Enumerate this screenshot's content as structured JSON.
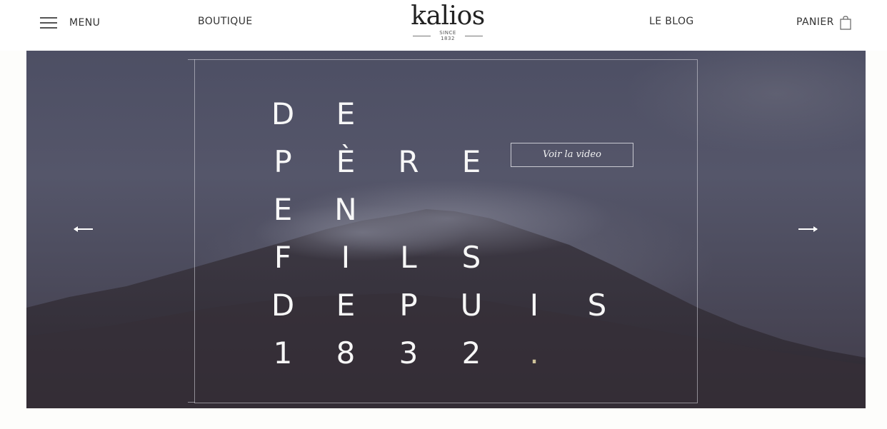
{
  "header": {
    "menu_label": "MENU",
    "boutique_label": "BOUTIQUE",
    "logo_text": "kalios",
    "logo_since": "SINCE 1832",
    "blog_label": "LE BLOG",
    "cart_label": "PANIER"
  },
  "hero": {
    "headline_rows": [
      [
        "D",
        "E"
      ],
      [
        "P",
        "È",
        "R",
        "E"
      ],
      [
        "E",
        "N"
      ],
      [
        "F",
        "I",
        "L",
        "S"
      ],
      [
        "D",
        "E",
        "P",
        "U",
        "I",
        "S"
      ],
      [
        "1",
        "8",
        "3",
        "2",
        "."
      ]
    ],
    "video_button_label": "Voir la video"
  },
  "colors": {
    "accent_dot": "#cfc39a",
    "hero_bg": "#4e4f63"
  },
  "icons": {
    "menu": "hamburger-icon",
    "cart": "shopping-bag-icon",
    "prev": "arrow-left-icon",
    "next": "arrow-right-icon"
  }
}
